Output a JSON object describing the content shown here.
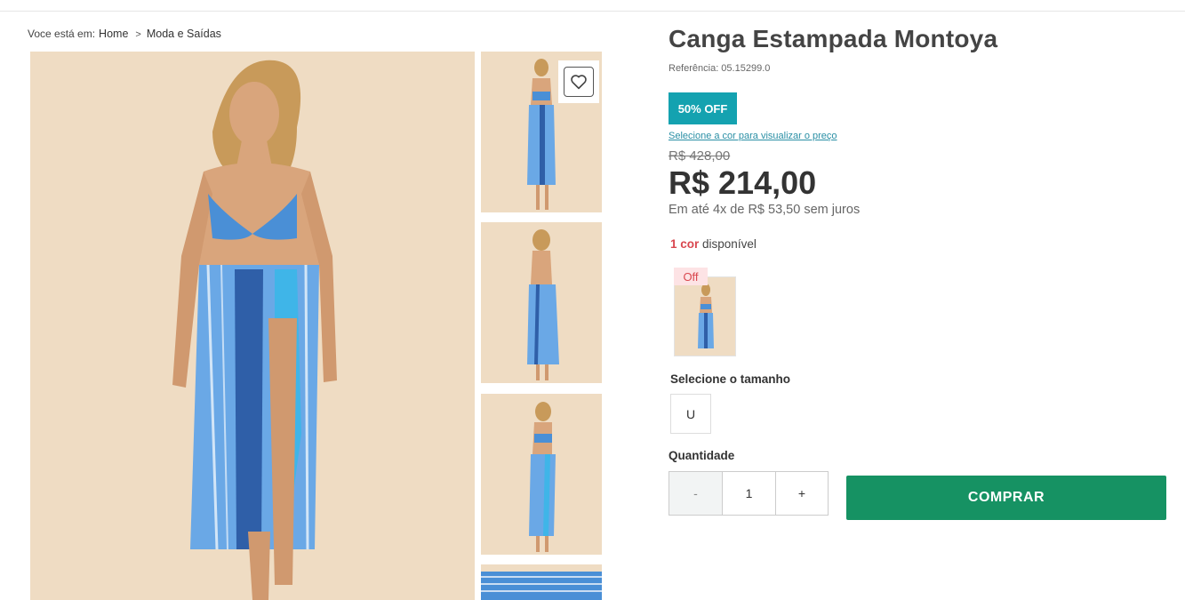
{
  "breadcrumb": {
    "prefix": "Voce está em:",
    "items": [
      "Home",
      "Moda e Saídas"
    ],
    "separator": ">"
  },
  "product": {
    "title": "Canga Estampada Montoya",
    "reference": "Referência: 05.15299.0",
    "discount_badge": "50% OFF",
    "select_color_link": "Selecione a cor para visualizar o preço",
    "old_price": "R$ 428,00",
    "price": "R$ 214,00",
    "installments": "Em até 4x de R$ 53,50 sem juros",
    "colors_count": "1 cor",
    "colors_suffix": " disponível",
    "swatch_tag": "Off",
    "size_label": "Selecione o tamanho",
    "sizes": [
      "U"
    ],
    "quantity_label": "Quantidade",
    "quantity_minus": "-",
    "quantity_value": "1",
    "quantity_plus": "+",
    "buy_label": "COMPRAR"
  },
  "icons": {
    "favorite": "heart-icon"
  },
  "colors": {
    "badge": "#14a2b0",
    "buy_button": "#169263",
    "accent_red": "#d9474f",
    "link": "#2a8fa5",
    "photo_background": "#efdcc3"
  }
}
